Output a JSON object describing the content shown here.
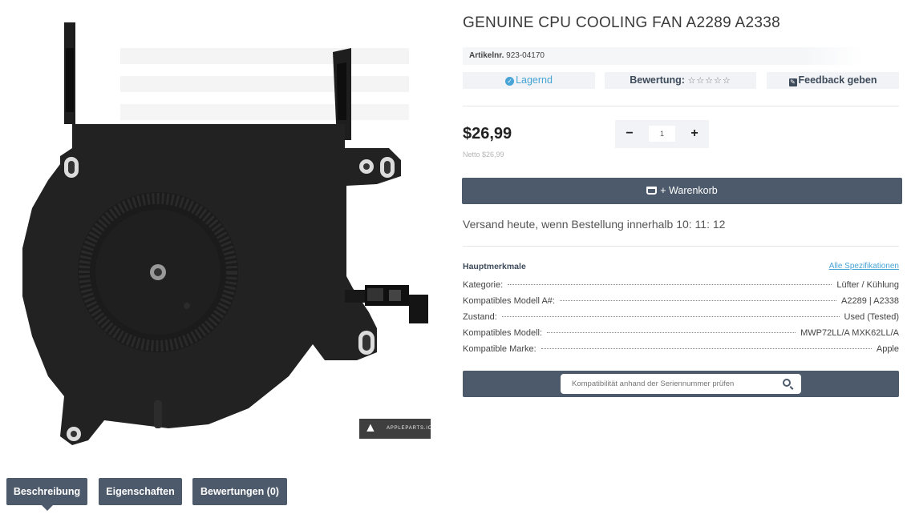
{
  "product": {
    "title": "GENUINE CPU COOLING FAN A2289 A2338",
    "sku_label": "Artikelnr.",
    "sku_value": "923-04170",
    "stock_label": "Lagernd",
    "rating_label": "Bewertung:",
    "rating_stars": "☆☆☆☆☆",
    "feedback_label": "Feedback geben",
    "price": "$26,99",
    "netto": "Netto $26,99",
    "quantity": "1",
    "cart_label": "+ Warenkorb",
    "shipping_text": "Versand heute, wenn Bestellung innerhalb 10: 11: 12",
    "watermark": "APPLEPARTS.IO"
  },
  "features": {
    "heading": "Hauptmerkmale",
    "all_specs_link": "Alle Spezifikationen",
    "rows": [
      {
        "key": "Kategorie:",
        "value": "Lüfter / Kühlung"
      },
      {
        "key": "Kompatibles Modell A#:",
        "value": "A2289 | A2338"
      },
      {
        "key": "Zustand:",
        "value": "Used (Tested)"
      },
      {
        "key": "Kompatibles Modell:",
        "value": "MWP72LL/A MXK62LL/A"
      },
      {
        "key": "Kompatible Marke:",
        "value": "Apple"
      }
    ]
  },
  "serial_check": {
    "placeholder": "Kompatibilität anhand der Seriennummer prüfen"
  },
  "tabs": [
    {
      "label": "Beschreibung"
    },
    {
      "label": "Eigenschaften"
    },
    {
      "label": "Bewertungen (0)"
    }
  ],
  "colors": {
    "accent": "#48a4d6",
    "dark_button": "#4d5a6b"
  }
}
